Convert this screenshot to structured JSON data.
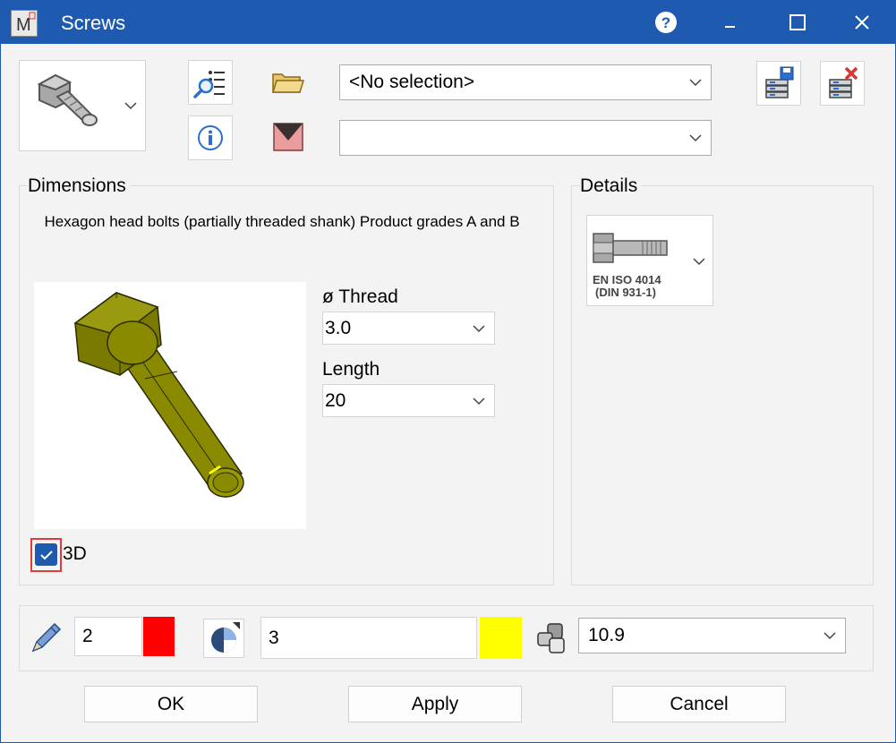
{
  "window": {
    "title": "Screws",
    "app_icon_letter": "M"
  },
  "toolbar": {
    "folder_combo_value": "<No selection>",
    "second_combo_value": ""
  },
  "dimensions": {
    "title": "Dimensions",
    "description": "Hexagon head bolts (partially threaded shank) Product grades A and B",
    "thread_label": "ø Thread",
    "thread_value": "3.0",
    "length_label": "Length",
    "length_value": "20",
    "checkbox_3d_label": "3D",
    "checkbox_3d_checked": true
  },
  "details": {
    "title": "Details",
    "standard_line1": "EN ISO 4014",
    "standard_line2": "(DIN 931-1)"
  },
  "bottom": {
    "pen_width": "2",
    "pen_color": "#ff0000",
    "layer_value": "3",
    "layer_color": "#ffff00",
    "strength_class": "10.9"
  },
  "buttons": {
    "ok": "OK",
    "apply": "Apply",
    "cancel": "Cancel"
  },
  "colors": {
    "titlebar": "#1e5bb0",
    "bolt": "#8a8a00",
    "highlight": "#e03c3c"
  }
}
